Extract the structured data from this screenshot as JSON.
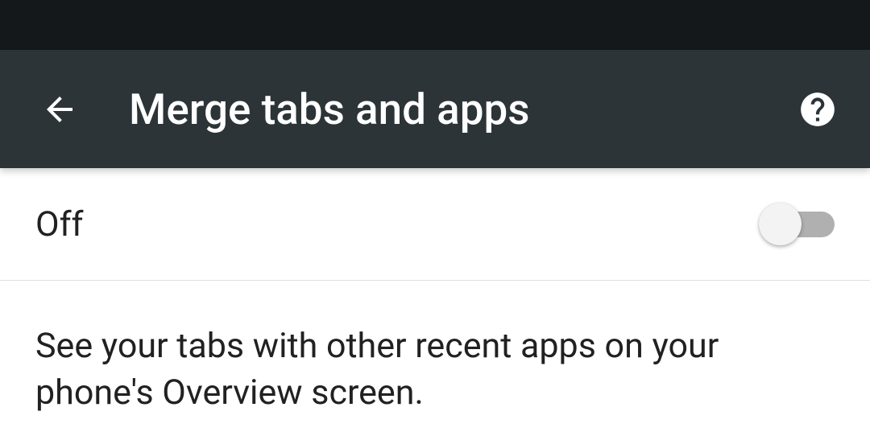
{
  "header": {
    "title": "Merge tabs and apps"
  },
  "setting": {
    "toggle_label": "Off",
    "toggle_state": false,
    "description": "See your tabs with other recent apps on your phone's Overview screen."
  }
}
